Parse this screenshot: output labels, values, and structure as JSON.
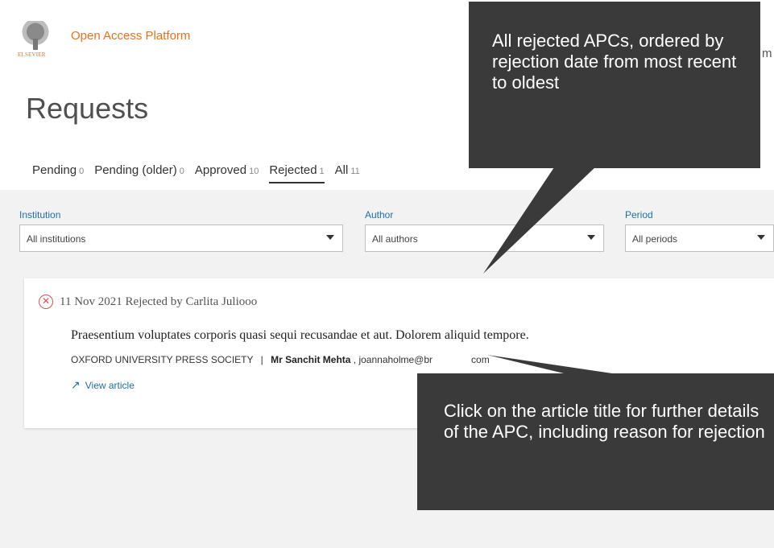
{
  "header": {
    "logo_text": "ELSEVIER",
    "platform": "Open Access Platform",
    "edge_fragment": "m"
  },
  "page_title": "Requests",
  "tabs": [
    {
      "label": "Pending",
      "count": "0"
    },
    {
      "label": "Pending (older)",
      "count": "0"
    },
    {
      "label": "Approved",
      "count": "10"
    },
    {
      "label": "Rejected",
      "count": "1"
    },
    {
      "label": "All",
      "count": "11"
    }
  ],
  "filters": {
    "institution": {
      "label": "Institution",
      "value": "All institutions"
    },
    "author": {
      "label": "Author",
      "value": "All authors"
    },
    "period": {
      "label": "Period",
      "value": "All periods"
    }
  },
  "card": {
    "status": "11 Nov 2021 Rejected by Carlita Juliooo",
    "article_title": "Praesentium voluptates corporis quasi sequi recusandae et aut. Dolorem aliquid tempore.",
    "publisher": "OXFORD UNIVERSITY PRESS SOCIETY",
    "separator": "|",
    "author": "Mr Sanchit Mehta",
    "email": ", joannaholme@br",
    "email_tail": "com",
    "view_label": "View article"
  },
  "callouts": {
    "top": "All rejected APCs, ordered by rejection date from most recent to oldest",
    "bottom": "Click on the article title for further details of the APC, including reason for rejection"
  },
  "colors": {
    "accent": "#e9711c",
    "link": "#1f6fa8",
    "reject": "#d9534f",
    "callout_bg": "#3a3a3a"
  }
}
